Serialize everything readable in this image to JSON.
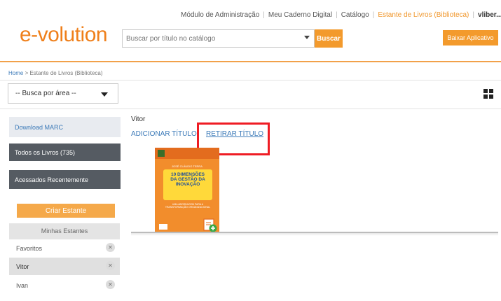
{
  "top_nav": {
    "items": [
      "Módulo de Administração",
      "Meu Caderno Digital",
      "Catálogo"
    ],
    "active": "Estante de Livros (Biblioteca)",
    "user": "vliber..."
  },
  "header": {
    "logo": "e-volution",
    "search_placeholder": "Buscar por título no catálogo",
    "search_button": "Buscar",
    "app_button": "Baixar Aplicativo"
  },
  "breadcrumb": {
    "home": "Home",
    "separator": " > ",
    "current": "Estante de Livros (Biblioteca)"
  },
  "area_select": {
    "value": "-- Busca por área --"
  },
  "sidebar": {
    "download_marc": "Download MARC",
    "all_books": "Todos os Livros (735)",
    "recent": "Acessados Recentemente",
    "create_shelf": "Criar Estante",
    "my_shelves": "Minhas Estantes",
    "shelves": [
      {
        "label": "Favoritos",
        "selected": false
      },
      {
        "label": "Vitor",
        "selected": true
      },
      {
        "label": "Ivan",
        "selected": false
      }
    ]
  },
  "main": {
    "shelf_name": "Vitor",
    "add_title": "ADICIONAR TÍTULO",
    "remove_title": "RETIRAR TÍTULO"
  },
  "book": {
    "author": "JOSÉ CLÁUDIO TERRA",
    "title_lines": [
      "10 DIMENSÕES",
      "DA GESTÃO DA",
      "INOVAÇÃO"
    ],
    "subtitle": "UMA ABORDAGEM PARA A TRANSFORMAÇÃO ORGANIZACIONAL"
  },
  "colors": {
    "brand_orange": "#ef7f1a",
    "button_orange": "#f39a2c",
    "link_blue": "#3c7ab8",
    "dark_sidebar": "#555b62",
    "highlight_red": "#ef1c24"
  }
}
